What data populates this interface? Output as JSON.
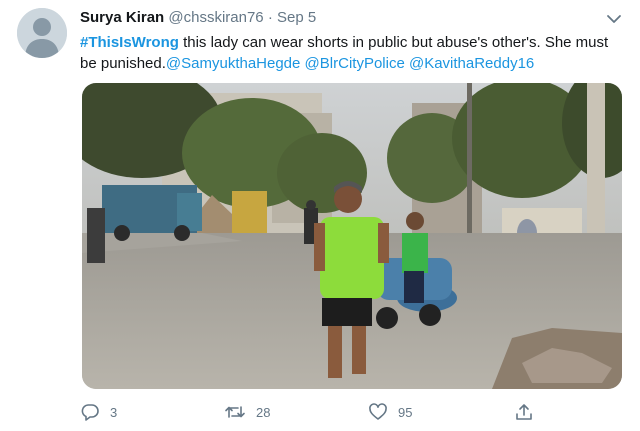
{
  "tweet": {
    "author": {
      "display_name": "Surya Kiran",
      "handle": "@chsskiran76",
      "separator": "·",
      "date": "Sep 5"
    },
    "text": {
      "hashtag": "#ThisIsWrong",
      "line1_rest": " this lady can wear shorts in public but abuse's other's. She must be punished.",
      "mentions": [
        "@SamyukthaHegde",
        "@BlrCityPolice",
        "@KavithaReddy16"
      ]
    },
    "actions": {
      "reply_count": "3",
      "retweet_count": "28",
      "like_count": "95"
    },
    "colors": {
      "link": "#1b95e0",
      "meta": "#657786"
    },
    "icons": [
      "default-avatar",
      "chevron-down-icon",
      "reply-icon",
      "retweet-icon",
      "like-icon",
      "share-icon"
    ]
  }
}
